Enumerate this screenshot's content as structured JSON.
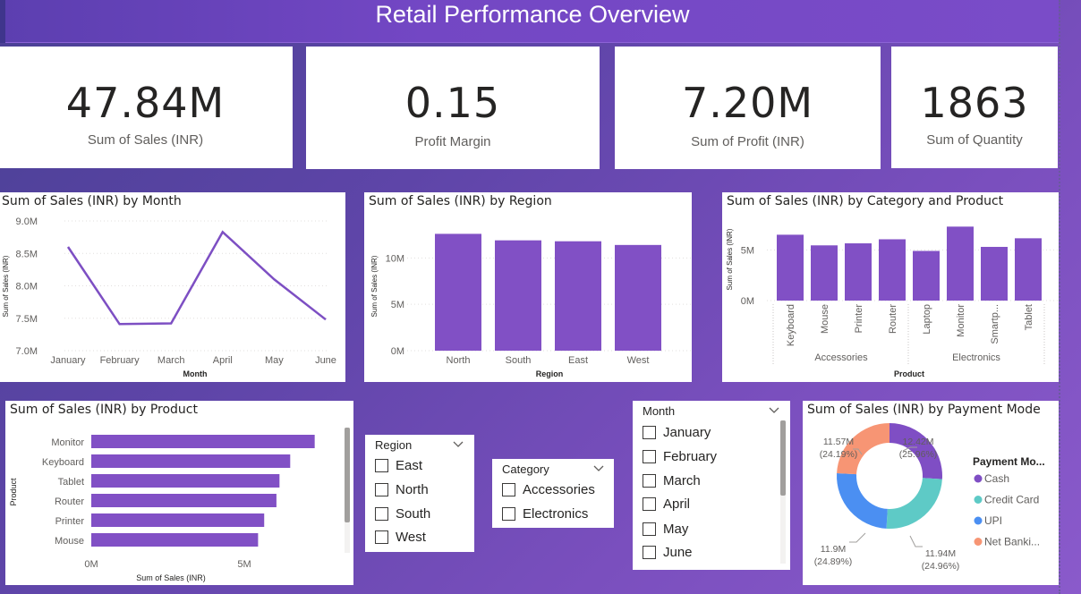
{
  "header": {
    "title": "Retail Performance Overview"
  },
  "kpis": [
    {
      "value": "47.84M",
      "label": "Sum of Sales (INR)"
    },
    {
      "value": "0.15",
      "label": "Profit Margin"
    },
    {
      "value": "7.20M",
      "label": "Sum of Profit (INR)"
    },
    {
      "value": "1863",
      "label": "Sum of Quantity"
    }
  ],
  "colors": {
    "bar": "#8150c5",
    "line": "#7d4fc3",
    "cash": "#7f4ec4",
    "credit_card": "#5ecac6",
    "upi": "#4b8ff2",
    "net_banking": "#f79574",
    "accent_title": "#6e46bd"
  },
  "chart_data": [
    {
      "type": "line",
      "title": "Sum of Sales (INR) by Month",
      "xlabel": "Month",
      "ylabel": "Sum of Sales (INR)",
      "categories": [
        "January",
        "February",
        "March",
        "April",
        "May",
        "June"
      ],
      "values": [
        8.6,
        7.41,
        7.42,
        8.83,
        8.1,
        7.48
      ],
      "unit": "M",
      "ylim": [
        7.0,
        9.0
      ],
      "yticks": [
        "7.0M",
        "7.5M",
        "8.0M",
        "8.5M",
        "9.0M"
      ],
      "grid": true
    },
    {
      "type": "bar",
      "title": "Sum of Sales (INR) by Region",
      "xlabel": "Region",
      "ylabel": "Sum of Sales (INR)",
      "categories": [
        "North",
        "South",
        "East",
        "West"
      ],
      "values": [
        12.6,
        11.9,
        11.8,
        11.4
      ],
      "unit": "M",
      "ylim": [
        0,
        13.7
      ],
      "yticks": [
        "0M",
        "5M",
        "10M"
      ],
      "grid": true
    },
    {
      "type": "bar",
      "title": "Sum of Sales (INR) by Category and Product",
      "xlabel": "Product",
      "ylabel": "Sum of Sales (INR)",
      "categories": [
        "Keyboard",
        "Mouse",
        "Printer",
        "Router",
        "Laptop",
        "Monitor",
        "Smartp...",
        "Tablet"
      ],
      "groups": [
        {
          "name": "Accessories",
          "count": 4
        },
        {
          "name": "Electronics",
          "count": 4
        }
      ],
      "values": [
        6.5,
        5.45,
        5.65,
        6.05,
        4.9,
        7.3,
        5.3,
        6.15
      ],
      "unit": "M",
      "ylim": [
        0,
        8.3
      ],
      "yticks": [
        "0M",
        "5M"
      ],
      "grid": true
    },
    {
      "type": "bar",
      "orientation": "horizontal",
      "title": "Sum of Sales (INR) by Product",
      "xlabel": "Sum of Sales (INR)",
      "ylabel": "Product",
      "categories": [
        "Monitor",
        "Keyboard",
        "Tablet",
        "Router",
        "Printer",
        "Mouse"
      ],
      "values": [
        7.3,
        6.5,
        6.15,
        6.05,
        5.65,
        5.45
      ],
      "unit": "M",
      "xlim": [
        0,
        8.3
      ],
      "xticks": [
        "0M",
        "5M"
      ]
    },
    {
      "type": "pie",
      "donut": true,
      "title": "Sum of Sales (INR) by Payment Mode",
      "legend_title": "Payment Mo...",
      "legend_position": "right",
      "slices": [
        {
          "name": "Cash",
          "value": 12.42,
          "label": "12.42M",
          "pct": "(25.96%)"
        },
        {
          "name": "Credit Card",
          "value": 11.94,
          "label": "11.94M",
          "pct": "(24.96%)"
        },
        {
          "name": "UPI",
          "value": 11.9,
          "label": "11.9M",
          "pct": "(24.89%)"
        },
        {
          "name": "Net Banki...",
          "value": 11.57,
          "label": "11.57M",
          "pct": "(24.19%)"
        }
      ]
    }
  ],
  "slicers": {
    "region": {
      "title": "Region",
      "items": [
        "East",
        "North",
        "South",
        "West"
      ]
    },
    "category": {
      "title": "Category",
      "items": [
        "Accessories",
        "Electronics"
      ]
    },
    "month": {
      "title": "Month",
      "items": [
        "January",
        "February",
        "March",
        "April",
        "May",
        "June"
      ]
    }
  }
}
